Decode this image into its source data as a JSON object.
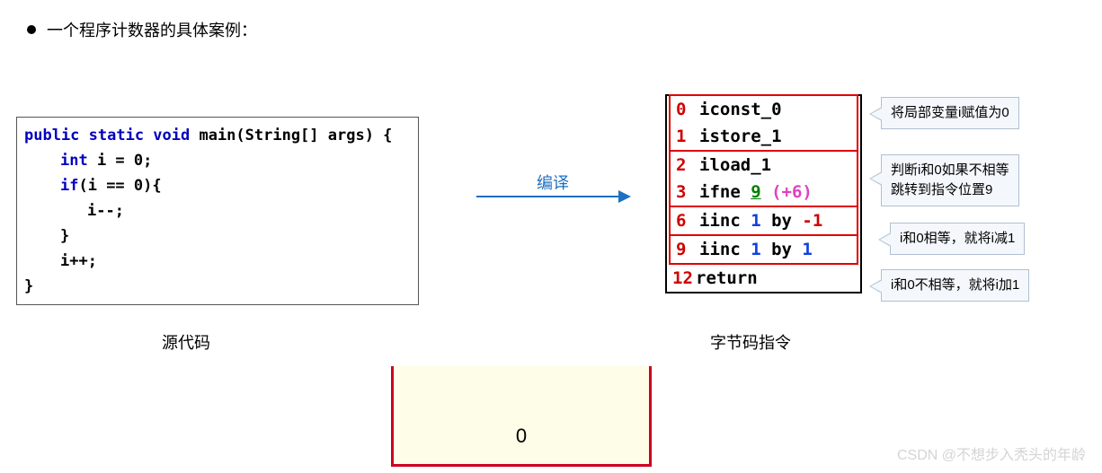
{
  "title": "一个程序计数器的具体案例：",
  "source": {
    "caption": "源代码",
    "lines": {
      "l1_kw": "public static void",
      "l1_rest": " main(String[] args) {",
      "l2_kw": "int",
      "l2_rest": " i = 0;",
      "l3_kw": "if",
      "l3_rest": "(i == 0){",
      "l4": "i--;",
      "l5": "}",
      "l6": "i++;",
      "l7": "}"
    }
  },
  "arrow_label": "编译",
  "bytecode": {
    "caption": "字节码指令",
    "rows": [
      {
        "n": "0",
        "op": "iconst_0"
      },
      {
        "n": "1",
        "op": "istore_1"
      },
      {
        "n": "2",
        "op": "iload_1"
      },
      {
        "n": "3",
        "op": "ifne ",
        "green": "9",
        "pink": " (+6)"
      },
      {
        "n": "6",
        "op": "iinc ",
        "blue": "1",
        "mid": " by ",
        "red": "-1"
      },
      {
        "n": "9",
        "op": "iinc ",
        "blue": "1",
        "mid": " by ",
        "blue2": "1"
      },
      {
        "n": "12",
        "op": "return"
      }
    ]
  },
  "callouts": {
    "c1": "将局部变量i赋值为0",
    "c2a": "判断i和0如果不相等",
    "c2b": "跳转到指令位置9",
    "c3": "i和0相等，就将i减1",
    "c4": "i和0不相等，就将i加1"
  },
  "bottom_value": "0",
  "watermark": "CSDN @不想步入秃头的年龄"
}
